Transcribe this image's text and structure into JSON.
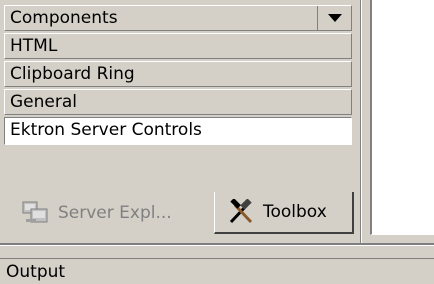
{
  "toolbox": {
    "categories": [
      {
        "label": "Components",
        "has_dropdown": true,
        "icon": "chevron-down-icon"
      },
      {
        "label": "HTML"
      },
      {
        "label": "Clipboard Ring"
      },
      {
        "label": "General"
      },
      {
        "label": "Ektron Server Controls",
        "active": true
      }
    ]
  },
  "tabs": [
    {
      "label": "Server Expl...",
      "icon": "server-explorer-icon",
      "selected": false
    },
    {
      "label": "Toolbox",
      "icon": "toolbox-hammer-icon",
      "selected": true
    }
  ],
  "output": {
    "label": "Output"
  },
  "colors": {
    "face": "#d4d0c8",
    "highlight": "#ffffff",
    "shadow": "#808080",
    "disabled_text": "#808080"
  }
}
